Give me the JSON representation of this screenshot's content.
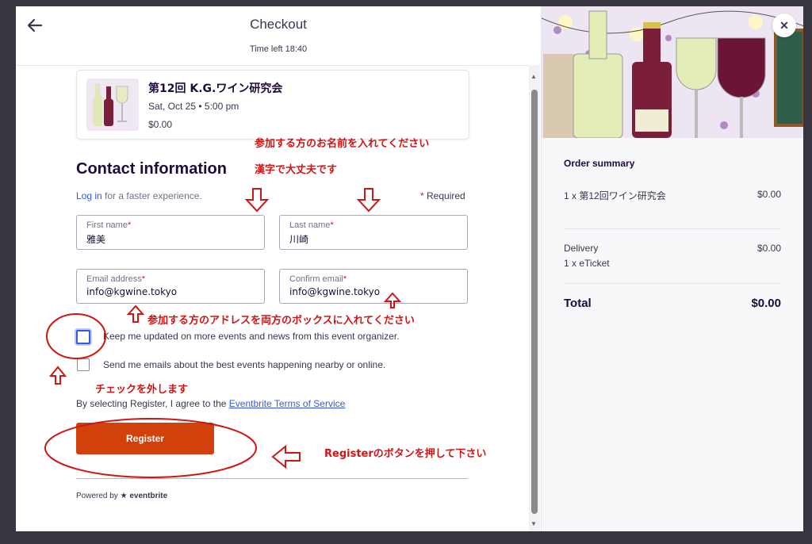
{
  "header": {
    "title": "Checkout",
    "time_left": "Time left 18:40"
  },
  "event": {
    "title": "第12回 K.G.ワイン研究会",
    "date": "Sat, Oct 25 • 5:00 pm",
    "price": "$0.00"
  },
  "contact": {
    "heading": "Contact information",
    "login_link": "Log in",
    "login_rest": " for a faster experience.",
    "required_label": "Required",
    "first_name": {
      "label": "First name",
      "value": "雅美"
    },
    "last_name": {
      "label": "Last name",
      "value": "川崎"
    },
    "email": {
      "label": "Email address",
      "value": "info@kgwine.tokyo"
    },
    "confirm_email": {
      "label": "Confirm email",
      "value": "info@kgwine.tokyo"
    }
  },
  "options": {
    "keep_updated": "Keep me updated on more events and news from this event organizer.",
    "send_emails": "Send me emails about the best events happening nearby or online."
  },
  "terms": {
    "prefix": "By selecting Register, I agree to the ",
    "link": "Eventbrite Terms of Service"
  },
  "register_label": "Register",
  "powered": {
    "prefix": "Powered by",
    "brand": "eventbrite"
  },
  "summary": {
    "title": "Order summary",
    "item_label": "1 x 第12回ワイン研究会",
    "item_amount": "$0.00",
    "delivery_label": "Delivery",
    "delivery_detail": "1 x eTicket",
    "delivery_amount": "$0.00",
    "total_label": "Total",
    "total_amount": "$0.00"
  },
  "annotations": {
    "name_note": "参加する方のお名前を入れてください",
    "kanji_note": "漢字で大丈夫です",
    "address_note": "参加する方のアドレスを両方のボックスに入れてください",
    "uncheck_note": "チェックを外します",
    "register_note": "Registerのボタンを押して下さい"
  },
  "colors": {
    "brand": "#d1410c",
    "link": "#3659e3",
    "annotation": "#d01515",
    "text": "#39364f"
  },
  "icons": {
    "back": "arrow-left-icon",
    "close": "close-icon"
  }
}
